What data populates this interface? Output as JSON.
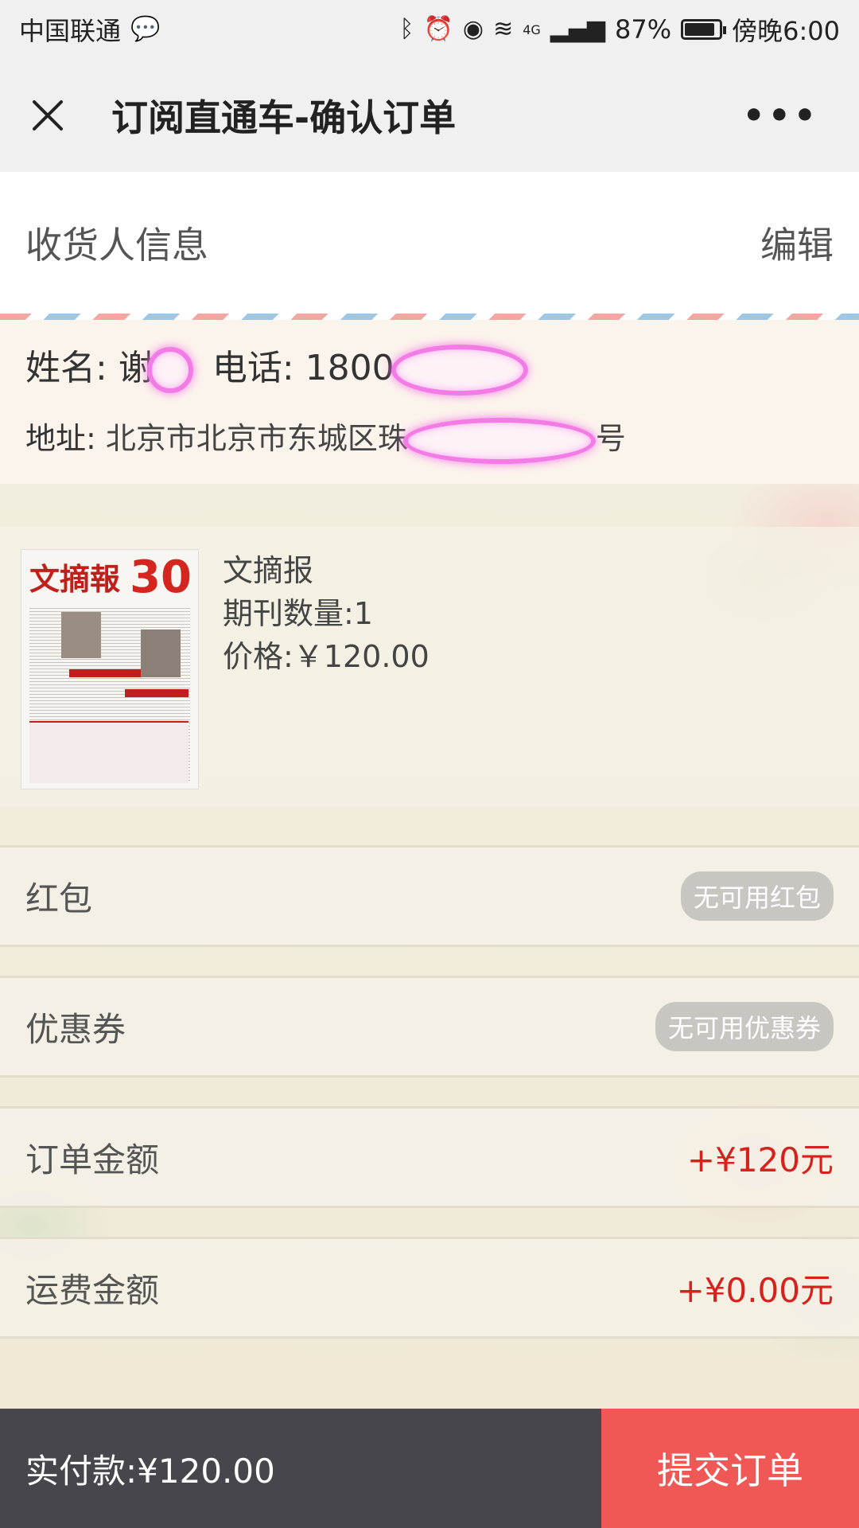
{
  "status_bar": {
    "carrier": "中国联通",
    "network": "4G",
    "battery": "87%",
    "battery_level": 0.87,
    "time": "傍晚6:00"
  },
  "nav": {
    "title": "订阅直通车-确认订单",
    "more": "•••"
  },
  "receiver": {
    "section_title": "收货人信息",
    "edit_label": "编辑",
    "name_label": "姓名:",
    "name_value": "谢",
    "phone_label": "电话:",
    "phone_value": "1800",
    "address_label": "地址:",
    "address_value": "北京市北京市东城区珠",
    "address_suffix": "号"
  },
  "product": {
    "name": "文摘报",
    "quantity": "期刊数量:1",
    "price": "价格:￥120.00",
    "thumb_masthead": "文摘報",
    "thumb_badge": "30"
  },
  "rows": {
    "red_packet": {
      "label": "红包",
      "value": "无可用红包"
    },
    "coupon": {
      "label": "优惠券",
      "value": "无可用优惠券"
    },
    "order_amount": {
      "label": "订单金额",
      "value": "+¥120元"
    },
    "shipping_amount": {
      "label": "运费金额",
      "value": "+¥0.00元"
    }
  },
  "bottom_bar": {
    "total": "实付款:¥120.00",
    "submit_label": "提交订单"
  },
  "colors": {
    "accent_red": "#d7211c",
    "submit_bg": "#ef5855",
    "bottom_bg": "#47464c"
  }
}
